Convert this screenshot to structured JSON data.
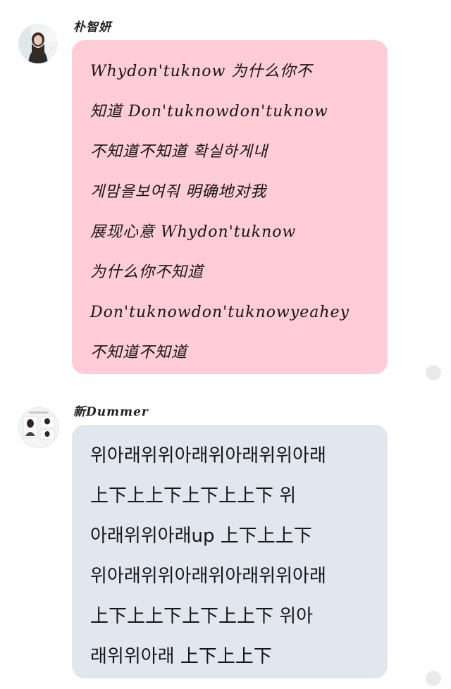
{
  "messages": [
    {
      "sender": "朴智妍",
      "bubble_color": "#ffccd8",
      "lines": [
        "Whydon'tuknow  为什么你不",
        "知道  Don'tuknowdon'tuknow",
        "不知道不知道  확실하게내",
        "게맘을보여줘  明确地对我",
        "展现心意  Whydon'tuknow",
        "为什么你不知道",
        "Don'tuknowdon'tuknowyeahey",
        "不知道不知道"
      ]
    },
    {
      "sender": "新Dummer",
      "bubble_color": "#e2e6ee",
      "lines": [
        "위아래위위아래위아래위위아래",
        "上下上上下上下上上下  위",
        "아래위위아래up  上下上上下",
        "위아래위위아래위아래위위아래",
        "上下上上下上下上上下  위아",
        "래위위아래  上下上上下"
      ]
    }
  ]
}
